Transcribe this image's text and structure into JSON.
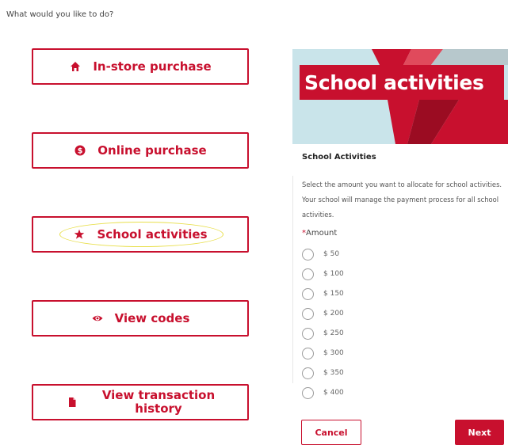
{
  "prompt": "What would you like to do?",
  "options": [
    {
      "label": "In-store purchase",
      "icon": "home-icon"
    },
    {
      "label": "Online purchase",
      "icon": "dollar-icon"
    },
    {
      "label": "School activities",
      "icon": "star-icon",
      "selected": true
    },
    {
      "label": "View codes",
      "icon": "eye-icon"
    },
    {
      "label_line1": "View transaction",
      "label_line2": "history",
      "icon": "document-icon"
    }
  ],
  "panel": {
    "banner_title": "School activities",
    "section_title": "School Activities",
    "description": "Select the amount you want to allocate for school activities. Your school will manage the payment process for all school activities.",
    "amount_label": "Amount",
    "required_mark": "*",
    "amounts": [
      "$ 50",
      "$ 100",
      "$ 150",
      "$ 200",
      "$ 250",
      "$ 300",
      "$ 350",
      "$ 400"
    ],
    "cancel_label": "Cancel",
    "next_label": "Next"
  },
  "colors": {
    "accent": "#c8102e",
    "banner_bg": "#c9e4ea",
    "highlight": "#e8df4a"
  }
}
